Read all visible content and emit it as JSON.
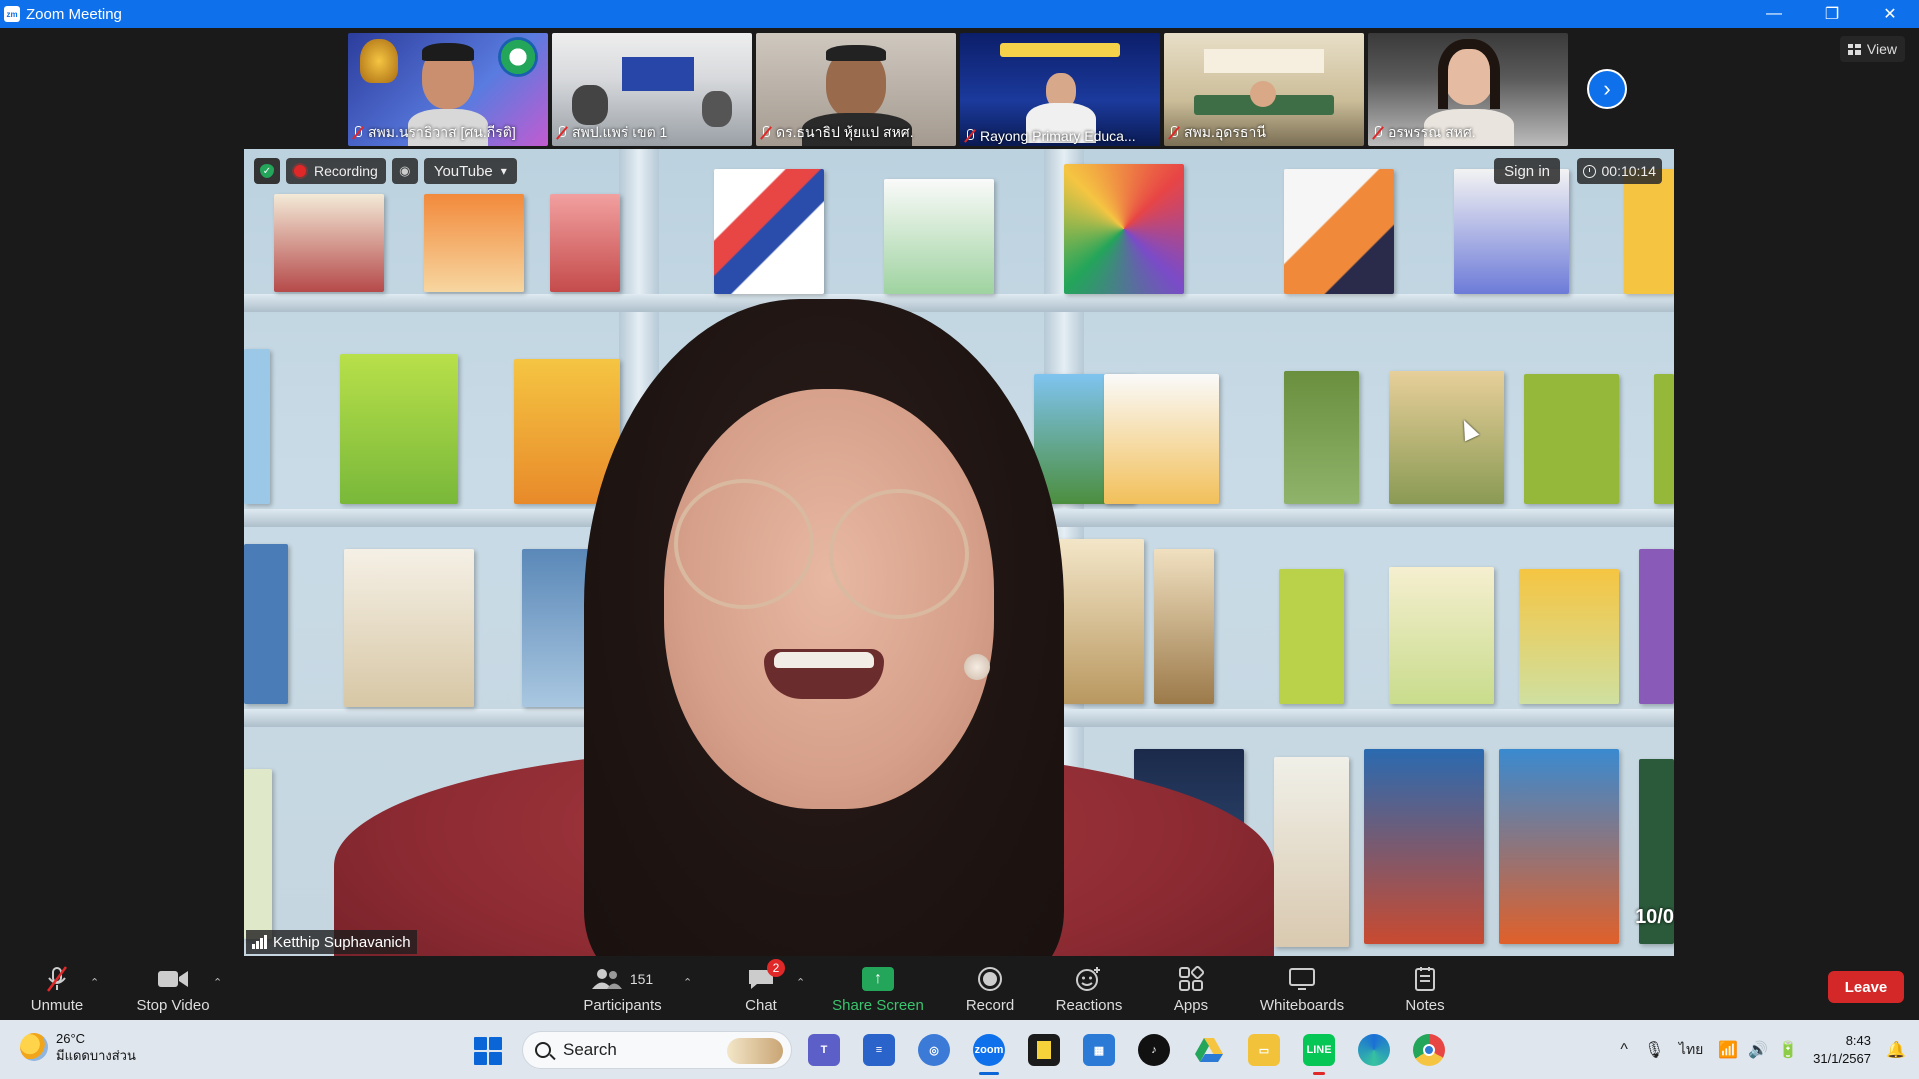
{
  "window": {
    "title": "Zoom Meeting",
    "app_logo": "zm",
    "minimize": "—",
    "restore": "❐",
    "close": "✕"
  },
  "gallery": {
    "participants": [
      {
        "name": "สพม.นราธิวาส [ศน.กีรติ]",
        "muted": true
      },
      {
        "name": "สพป.แพร่ เขต 1",
        "muted": true
      },
      {
        "name": "ดร.ธนาธิป หุ้ยแป สหศ.",
        "muted": true
      },
      {
        "name": "Rayong Primary Educa...",
        "muted": true
      },
      {
        "name": "สพม.อุดรธานี",
        "muted": true
      },
      {
        "name": "อรพรรณ สหศ.",
        "muted": true
      }
    ],
    "next_icon": "›",
    "view_label": "View"
  },
  "video": {
    "recording_label": "Recording",
    "stream_target": "YouTube",
    "sign_in": "Sign in",
    "timer": "00:10:14",
    "speaker_name": "Ketthip Suphavanich",
    "shield_glyph": "✓",
    "dropdown_glyph": "▾",
    "live_glyph": "◉",
    "wall_corner_text": "10/0"
  },
  "toolbar": {
    "unmute": "Unmute",
    "stop_video": "Stop Video",
    "participants_label": "Participants",
    "participants_count": "151",
    "chat_label": "Chat",
    "chat_badge": "2",
    "share_screen": "Share Screen",
    "record": "Record",
    "reactions": "Reactions",
    "apps": "Apps",
    "whiteboards": "Whiteboards",
    "notes": "Notes",
    "leave": "Leave",
    "caret": "⌃",
    "share_glyph": "↑"
  },
  "taskbar": {
    "temperature": "26°C",
    "weather_desc": "มีแดดบางส่วน",
    "search_placeholder": "Search",
    "time": "8:43",
    "date": "31/1/2567",
    "language": "ไทย",
    "up_glyph": "^",
    "mic_glyph": "🎙",
    "wifi_glyph": "📶",
    "volume_glyph": "🔊",
    "battery_glyph": "🔋",
    "bell_glyph": "🔔"
  },
  "colors": {
    "zoom_blue": "#0e71eb",
    "leave_red": "#d42727",
    "share_green": "#23a55a",
    "rec_red": "#e02828"
  }
}
